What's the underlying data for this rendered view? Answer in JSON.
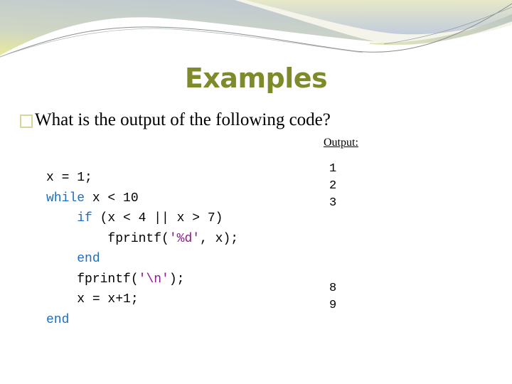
{
  "slide": {
    "title": "Examples",
    "bullet_icon": "square-bullet-icon",
    "bullet_text": "What is the output of the following code?",
    "output_label": "Output:"
  },
  "code_lines": [
    {
      "indent": 0,
      "tokens": [
        {
          "t": "x = 1;",
          "k": "plain"
        }
      ]
    },
    {
      "indent": 0,
      "tokens": [
        {
          "t": "while",
          "k": "keyword"
        },
        {
          "t": " x < 10",
          "k": "plain"
        }
      ]
    },
    {
      "indent": 1,
      "tokens": [
        {
          "t": "if",
          "k": "keyword"
        },
        {
          "t": " (x < 4 || x > 7)",
          "k": "plain"
        }
      ]
    },
    {
      "indent": 2,
      "tokens": [
        {
          "t": "fprintf(",
          "k": "plain"
        },
        {
          "t": "'%d'",
          "k": "string"
        },
        {
          "t": ", x);",
          "k": "plain"
        }
      ]
    },
    {
      "indent": 1,
      "tokens": [
        {
          "t": "end",
          "k": "keyword"
        }
      ]
    },
    {
      "indent": 1,
      "tokens": [
        {
          "t": "fprintf(",
          "k": "plain"
        },
        {
          "t": "'\\n'",
          "k": "string"
        },
        {
          "t": ");",
          "k": "plain"
        }
      ]
    },
    {
      "indent": 1,
      "tokens": [
        {
          "t": "x = x+1;",
          "k": "plain"
        }
      ]
    },
    {
      "indent": 0,
      "tokens": [
        {
          "t": "end",
          "k": "keyword"
        }
      ]
    }
  ],
  "output_lines": [
    "1",
    "2",
    "3",
    "",
    "",
    "",
    "",
    "8",
    "9"
  ],
  "colors": {
    "title": "#7f8a2a",
    "keyword": "#1f6fbf",
    "string": "#8b1a8b",
    "bullet": "#d6d89a"
  }
}
